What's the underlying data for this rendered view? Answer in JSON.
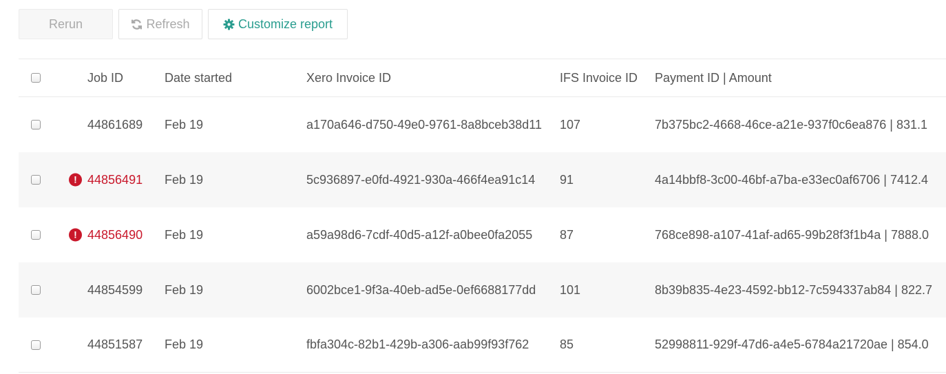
{
  "toolbar": {
    "rerun_label": "Rerun",
    "refresh_label": "Refresh",
    "customize_label": "Customize report"
  },
  "colors": {
    "accent": "#2a9d8f",
    "error": "#c9182b",
    "stripe": "#f7f7f7"
  },
  "table": {
    "headers": {
      "job_id": "Job ID",
      "date_started": "Date started",
      "xero_invoice_id": "Xero Invoice ID",
      "ifs_invoice_id": "IFS Invoice ID",
      "payment": "Payment ID | Amount"
    },
    "rows": [
      {
        "job_id": "44861689",
        "error": false,
        "date": "Feb 19",
        "xero": "a170a646-d750-49e0-9761-8a8bceb38d11",
        "ifs": "107",
        "payment": "7b375bc2-4668-46ce-a21e-937f0c6ea876 | 831.1"
      },
      {
        "job_id": "44856491",
        "error": true,
        "date": "Feb 19",
        "xero": "5c936897-e0fd-4921-930a-466f4ea91c14",
        "ifs": "91",
        "payment": "4a14bbf8-3c00-46bf-a7ba-e33ec0af6706 | 7412.4"
      },
      {
        "job_id": "44856490",
        "error": true,
        "date": "Feb 19",
        "xero": "a59a98d6-7cdf-40d5-a12f-a0bee0fa2055",
        "ifs": "87",
        "payment": "768ce898-a107-41af-ad65-99b28f3f1b4a | 7888.0"
      },
      {
        "job_id": "44854599",
        "error": false,
        "date": "Feb 19",
        "xero": "6002bce1-9f3a-40eb-ad5e-0ef6688177dd",
        "ifs": "101",
        "payment": "8b39b835-4e23-4592-bb12-7c594337ab84 | 822.7"
      },
      {
        "job_id": "44851587",
        "error": false,
        "date": "Feb 19",
        "xero": "fbfa304c-82b1-429b-a306-aab99f93f762",
        "ifs": "85",
        "payment": "52998811-929f-47d6-a4e5-6784a21720ae | 854.0"
      }
    ]
  }
}
